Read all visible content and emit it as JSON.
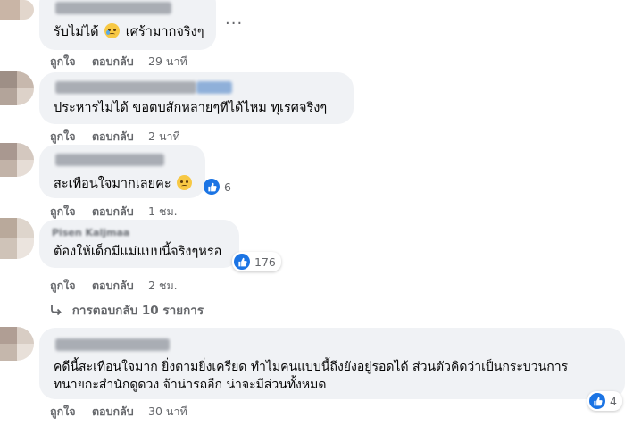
{
  "comments": [
    {
      "text": "รับไม่ได้",
      "text_after": "เศร้ามากจริงๆ",
      "emoji": "crying-face",
      "actions": {
        "like": "ถูกใจ",
        "reply": "ตอบกลับ",
        "time": "29 นาที"
      }
    },
    {
      "text": "ประหารไม่ได้ ขอตบสักหลายๆทีได้ไหม ทุเรศจริงๆ",
      "actions": {
        "like": "ถูกใจ",
        "reply": "ตอบกลับ",
        "time": "2 นาที"
      }
    },
    {
      "text": "สะเทือนใจมากเลยคะ",
      "emoji": "pleading-face",
      "reaction_count": "6",
      "actions": {
        "like": "ถูกใจ",
        "reply": "ตอบกลับ",
        "time": "1 ชม."
      }
    },
    {
      "author": "Pisen Kaljmaa",
      "text": "ต้องให้เด็กมีแม่แบบนี้จริงๆหรอ",
      "reaction_count": "176",
      "actions": {
        "like": "ถูกใจ",
        "reply": "ตอบกลับ",
        "time": "2 ชม."
      },
      "view_replies": "การตอบกลับ 10 รายการ"
    },
    {
      "text_line1": "คดีนี้สะเทือนใจมาก ยิ่งตามยิ่งเครียด ทำไมคนแบบนี้ถึงยังอยู่รอดได้ ส่วนตัวคิดว่าเป็นกระบวนการ",
      "text_line2": "ทนายกะสำนักดูดวง จ้าน่ารถอีก น่าจะมีส่วนทั้งหมด",
      "reaction_count": "4",
      "actions": {
        "like": "ถูกใจ",
        "reply": "ตอบกลับ",
        "time": "30 นาที"
      }
    }
  ],
  "icons": {
    "more": "more-horizontal-icon",
    "like": "thumbs-up-icon",
    "reply_arrow": "reply-arrow-icon"
  },
  "colors": {
    "bubble": "#f0f2f5",
    "meta_text": "#65676b",
    "like_blue": "#1b74e4",
    "text": "#050505"
  }
}
